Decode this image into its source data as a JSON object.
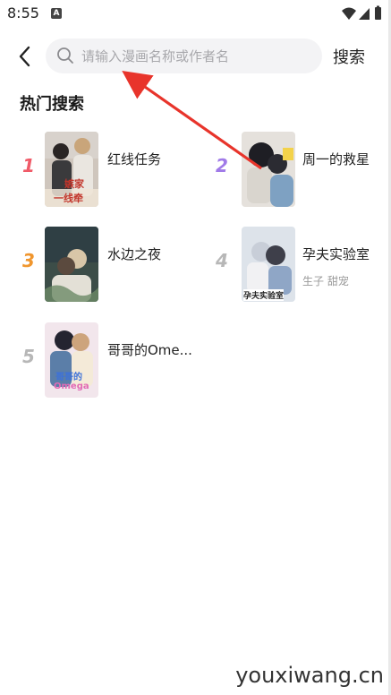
{
  "status_bar": {
    "time": "8:55",
    "notif_glyph": "A"
  },
  "search": {
    "placeholder": "请输入漫画名称或作者名",
    "button_label": "搜索"
  },
  "section_title": "热门搜索",
  "rank_colors": [
    "#f05a68",
    "#a07ae8",
    "#f0962e",
    "#b7b7b7",
    "#b7b7b7"
  ],
  "hot_items": [
    {
      "rank": "1",
      "title": "红线任务",
      "tags": "",
      "cover_text": [
        "嫉家",
        "一线牵"
      ]
    },
    {
      "rank": "2",
      "title": "周一的救星",
      "tags": "",
      "cover_text": []
    },
    {
      "rank": "3",
      "title": "水边之夜",
      "tags": "",
      "cover_text": []
    },
    {
      "rank": "4",
      "title": "孕夫实验室",
      "tags": "生子 甜宠",
      "cover_text": [
        "孕夫实验室"
      ]
    },
    {
      "rank": "5",
      "title": "哥哥的Ome...",
      "tags": "",
      "cover_text": [
        "哥哥的",
        "Omega"
      ]
    }
  ],
  "watermark": "youxiwang.cn",
  "icons": [
    "back-arrow-icon",
    "search-icon",
    "wifi-icon",
    "signal-icon",
    "battery-icon"
  ]
}
